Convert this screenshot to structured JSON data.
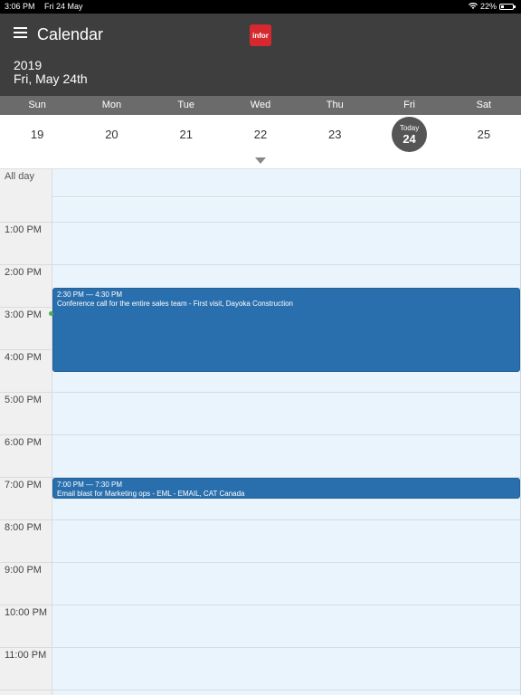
{
  "status_bar": {
    "time": "3:06 PM",
    "date": "Fri 24 May",
    "battery": "22%",
    "battery_level": 0.22
  },
  "header": {
    "title": "Calendar",
    "logo_text": "infor",
    "year": "2019",
    "full_date": "Fri, May 24th"
  },
  "week": {
    "days": [
      {
        "name": "Sun",
        "date": "19"
      },
      {
        "name": "Mon",
        "date": "20"
      },
      {
        "name": "Tue",
        "date": "21"
      },
      {
        "name": "Wed",
        "date": "22"
      },
      {
        "name": "Thu",
        "date": "23"
      },
      {
        "name": "Fri",
        "date": "24"
      },
      {
        "name": "Sat",
        "date": "25"
      }
    ],
    "today_label": "Today",
    "today_date": "24"
  },
  "day_view": {
    "all_day_label": "All day",
    "hours": [
      "1:00 PM",
      "2:00 PM",
      "3:00 PM",
      "4:00 PM",
      "5:00 PM",
      "6:00 PM",
      "7:00 PM",
      "8:00 PM",
      "9:00 PM",
      "10:00 PM",
      "11:00 PM"
    ]
  },
  "events": [
    {
      "time": "2:30 PM — 4:30 PM",
      "title": "Conference call for the entire sales team - First visit, Dayoka Construction"
    },
    {
      "time": "7:00 PM — 7:30 PM",
      "title": "Email blast for Marketing ops - EML - EMAIL, CAT Canada"
    }
  ],
  "colors": {
    "header_bg": "#3e3e3e",
    "weekday_bg": "#6b6b6b",
    "grid_bg": "#e9f4fd",
    "event_bg": "#2a6fad",
    "logo_red": "#d6282e"
  }
}
